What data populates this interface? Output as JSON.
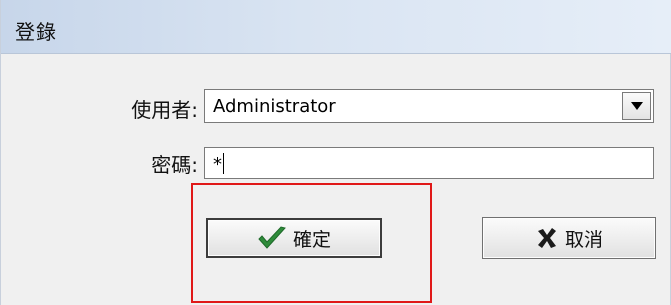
{
  "window": {
    "title": "登錄"
  },
  "form": {
    "user_label": "使用者:",
    "user_value": "Administrator",
    "password_label": "密碼:",
    "password_value": "*"
  },
  "buttons": {
    "ok_label": "確定",
    "ok_icon": "checkmark-icon",
    "cancel_label": "取消",
    "cancel_icon": "x-icon"
  },
  "colors": {
    "ok_check": "#2e8b3a",
    "cancel_x": "#1a1a1a",
    "highlight": "#e01818"
  }
}
